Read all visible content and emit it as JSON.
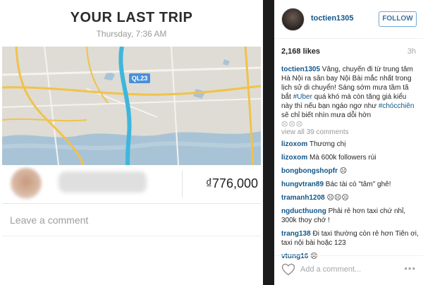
{
  "photo": {
    "title": "YOUR LAST TRIP",
    "time": "Thursday, 7:36 AM",
    "map_road_label": "QL23",
    "price": "₫776,000",
    "comment_placeholder": "Leave a comment"
  },
  "post": {
    "username": "toctien1305",
    "follow_label": "FOLLOW",
    "likes": "2,168 likes",
    "time_ago": "3h",
    "caption_user": "toctien1305",
    "caption_text_1": " Vâng, chuyến đi từ trung tâm Hà Nội ra sân bay Nội Bài mắc nhất trong lịch sử di chuyển! Sáng sớm mưa tầm tã bắt ",
    "caption_tag_1": "#Uber",
    "caption_text_2": " quá khó mà còn tăng giá kiểu này thì nếu bạn ngáo ngơ như ",
    "caption_tag_2": "#chócchiên",
    "caption_text_3": " sẽ chỉ biết nhìn mưa dỗi hờn",
    "caption_emoji": "☹☹☹",
    "view_all": "view all 39 comments",
    "comments": [
      {
        "user": "lizoxom",
        "text": " Thương chị"
      },
      {
        "user": "lizoxom",
        "text": " Mà 600k followers rùi"
      },
      {
        "user": "bongbongshopfr",
        "text": " ☹"
      },
      {
        "user": "hungvtran89",
        "text": " Bác tài có \"tâm\" ghê!"
      },
      {
        "user": "tramanh1208",
        "text": " ☹☹☹"
      },
      {
        "user": "ngducthuong",
        "text": " Phải rẻ hơn taxi chứ nhỉ, 300k thoy chớ !"
      },
      {
        "user": "trang138",
        "text": " Đi taxi thường còn rẻ hơn Tiên ơi, taxi nội bài hoặc 123"
      },
      {
        "user": "vtung16",
        "text": " ☹"
      }
    ],
    "add_comment_placeholder": "Add a comment...",
    "more_label": "•••"
  }
}
